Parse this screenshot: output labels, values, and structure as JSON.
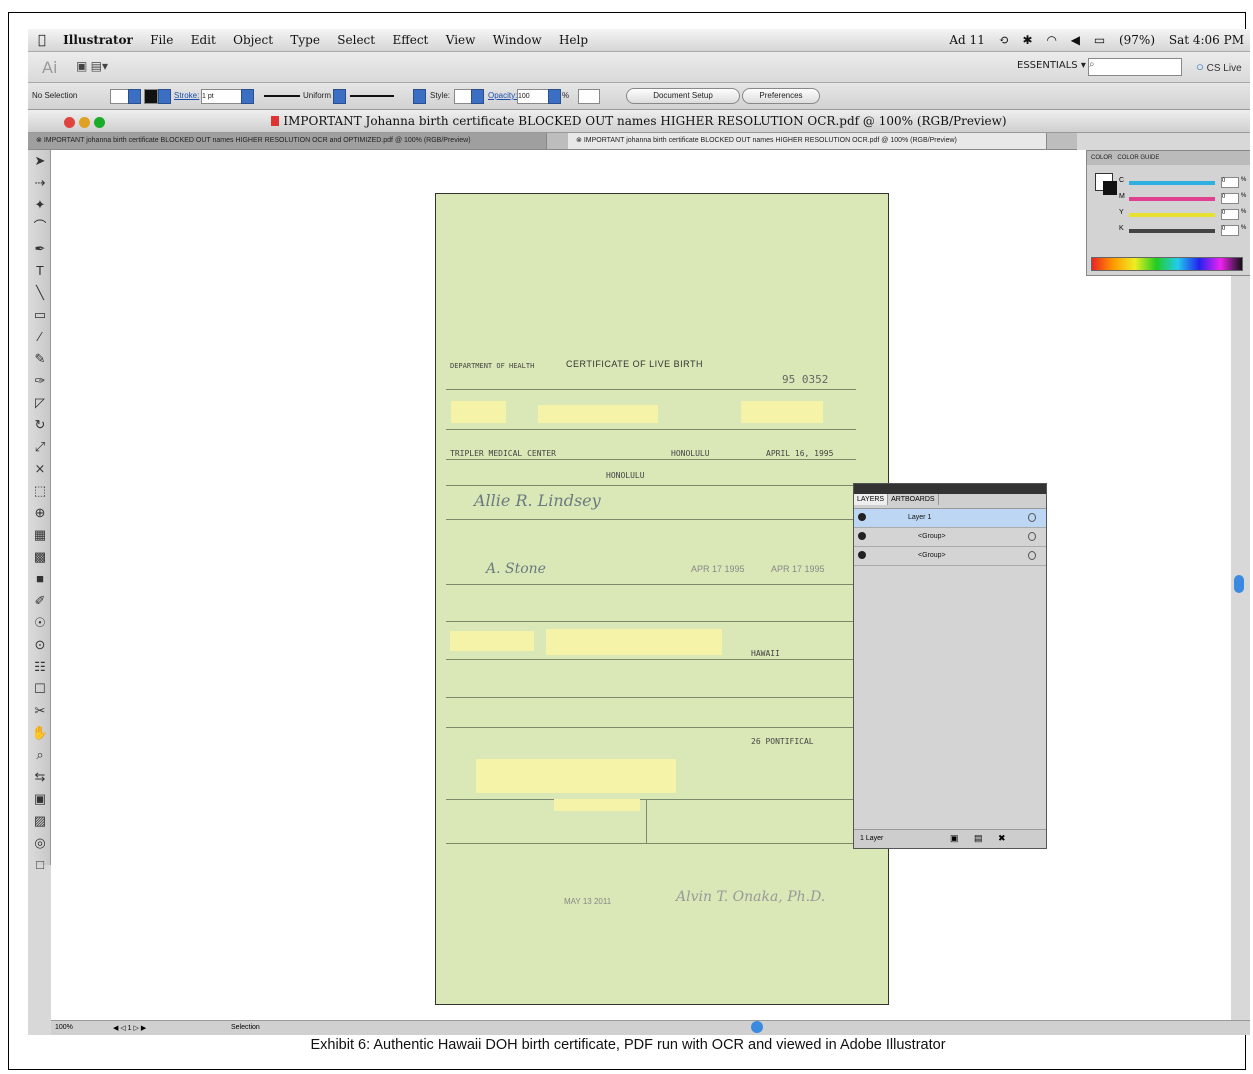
{
  "menubar": {
    "app": "Illustrator",
    "items": [
      "File",
      "Edit",
      "Object",
      "Type",
      "Select",
      "Effect",
      "View",
      "Window",
      "Help"
    ],
    "right": {
      "adobe": "Ad 11",
      "battery": "(97%)",
      "clock": "Sat 4:06 PM"
    }
  },
  "appbar": {
    "workspace": "ESSENTIALS",
    "cs_live": "CS Live"
  },
  "control": {
    "selection": "No Selection",
    "stroke_label": "Stroke:",
    "stroke_value": "1 pt",
    "uniform": "Uniform",
    "style_label": "Style:",
    "opacity_label": "Opacity:",
    "opacity_value": "100",
    "opacity_unit": "%",
    "document_setup": "Document Setup",
    "preferences": "Preferences"
  },
  "window": {
    "title": "IMPORTANT Johanna birth certificate BLOCKED OUT names HIGHER RESOLUTION OCR.pdf @ 100% (RGB/Preview)",
    "tabs": [
      "IMPORTANT johanna birth certificate BLOCKED OUT names HIGHER RESOLUTION OCR and OPTIMIZED.pdf @ 100% (RGB/Preview)",
      "IMPORTANT johanna birth certificate BLOCKED OUT names HIGHER RESOLUTION OCR.pdf @ 100% (RGB/Preview)"
    ]
  },
  "certificate": {
    "title": "CERTIFICATE OF LIVE BIRTH",
    "number": "95 0352",
    "hospital": "TRIPLER MEDICAL CENTER",
    "city": "HONOLULU",
    "date": "APRIL 16, 1995",
    "stamp_date": "APR 17 1995",
    "mother_city": "HONOLULU",
    "field_row1": "HAWAII",
    "field_row2": "26 PONTIFICAL",
    "doc_date": "MAY 13 2011",
    "signature": "Alvin T. Onaka, Ph.D."
  },
  "layers": {
    "tabs": [
      "LAYERS",
      "ARTBOARDS"
    ],
    "rows": [
      {
        "name": "Layer 1",
        "selected": true
      },
      {
        "name": "<Group>",
        "selected": false
      },
      {
        "name": "<Group>",
        "selected": false
      }
    ],
    "footer": "1 Layer"
  },
  "color_panel": {
    "tabs": [
      "COLOR",
      "COLOR GUIDE"
    ],
    "channels": [
      {
        "name": "C",
        "color": "#30b0e0",
        "value": "0"
      },
      {
        "name": "M",
        "color": "#e04090",
        "value": "0"
      },
      {
        "name": "Y",
        "color": "#e8e030",
        "value": "0"
      },
      {
        "name": "K",
        "color": "#444444",
        "value": "0"
      }
    ],
    "unit": "%"
  },
  "status": {
    "zoom": "100%",
    "page": "1",
    "tool": "Selection"
  },
  "caption": "Exhibit 6: Authentic Hawaii DOH birth certificate, PDF run with OCR and viewed in Adobe Illustrator"
}
